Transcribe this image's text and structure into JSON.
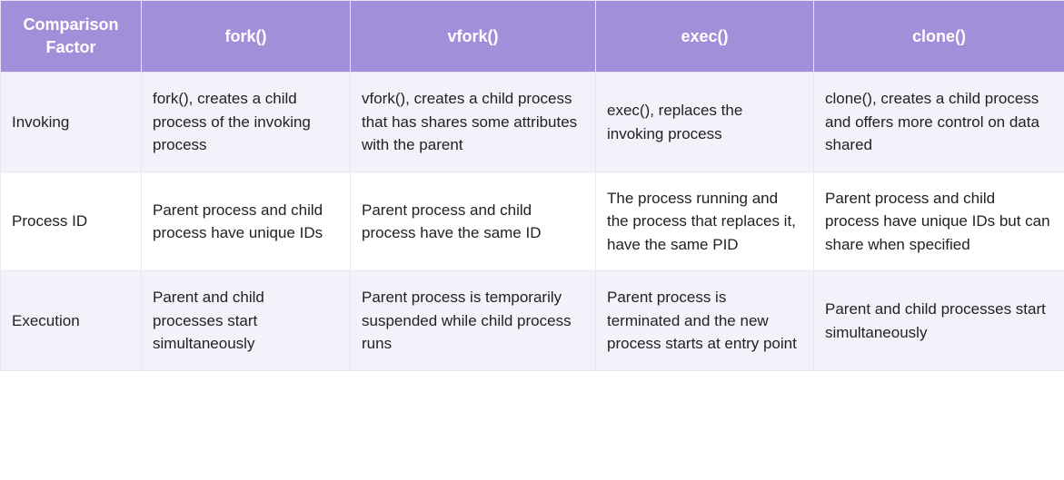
{
  "table": {
    "headers": [
      "Comparison Factor",
      "fork()",
      "vfork()",
      "exec()",
      "clone()"
    ],
    "rows": [
      {
        "label": "Invoking",
        "cells": [
          "fork(), creates a child process of the invoking process",
          "vfork(), creates a child process that has shares some attributes with the parent",
          "exec(), replaces the invoking process",
          "clone(), creates a child process and offers more control on data shared"
        ]
      },
      {
        "label": "Process ID",
        "cells": [
          "Parent process and child process have unique IDs",
          "Parent process and child process have the same ID",
          "The process running and the process that replaces it, have the same PID",
          "Parent process and child process have unique IDs but can share when specified"
        ]
      },
      {
        "label": "Execution",
        "cells": [
          "Parent and child processes start simultaneously",
          "Parent process is temporarily suspended while child process runs",
          "Parent process is terminated and the new process starts at entry point",
          "Parent and child processes start simultaneously"
        ]
      }
    ]
  }
}
